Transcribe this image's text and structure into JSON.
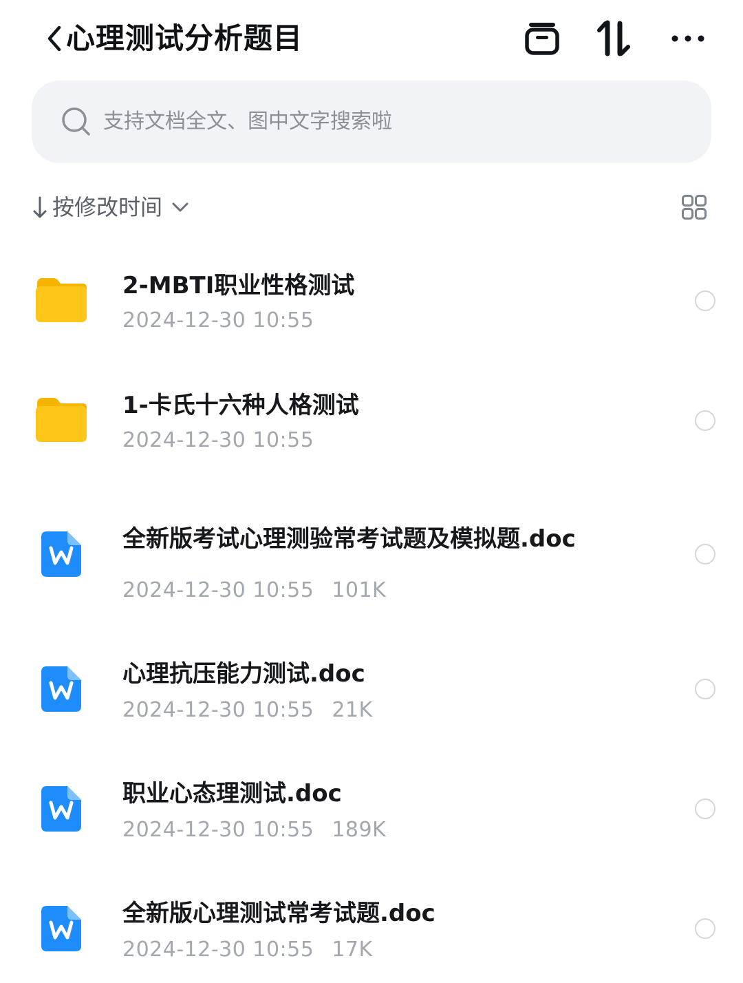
{
  "header": {
    "title": "心理测试分析题目",
    "icons": [
      "back-chevron-icon",
      "archive-box-icon",
      "sort-swap-icon",
      "more-icon"
    ]
  },
  "search": {
    "placeholder": "支持文档全文、图中文字搜索啦"
  },
  "sort": {
    "label": "按修改时间",
    "direction": "descending"
  },
  "files": [
    {
      "name": "2-MBTI职业性格测试",
      "type": "folder",
      "date": "2024-12-30 10:55",
      "size": ""
    },
    {
      "name": "1-卡氏十六种人格测试",
      "type": "folder",
      "date": "2024-12-30 10:55",
      "size": ""
    },
    {
      "name": "全新版考试心理测验常考试题及模拟题.doc",
      "type": "word",
      "date": "2024-12-30 10:55",
      "size": "101K"
    },
    {
      "name": "心理抗压能力测试.doc",
      "type": "word",
      "date": "2024-12-30 10:55",
      "size": "21K"
    },
    {
      "name": "职业心态理测试.doc",
      "type": "word",
      "date": "2024-12-30 10:55",
      "size": "189K"
    },
    {
      "name": "全新版心理测试常考试题.doc",
      "type": "word",
      "date": "2024-12-30 10:55",
      "size": "17K"
    }
  ],
  "colors": {
    "folder": "#ffc61a",
    "word": "#1f8cfb",
    "meta_text": "#a3a7ae",
    "search_bg": "#f1f3f6"
  }
}
